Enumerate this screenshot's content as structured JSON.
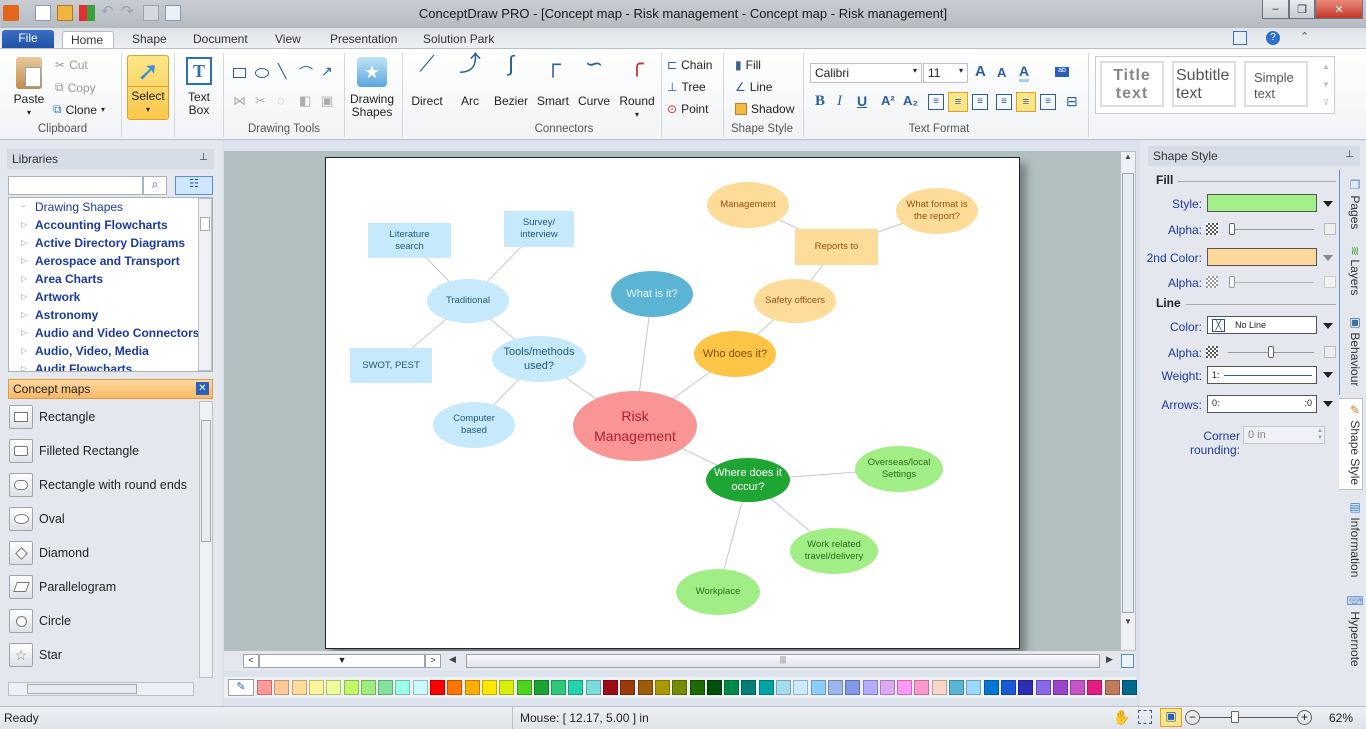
{
  "window": {
    "title": "ConceptDraw PRO - [Concept map - Risk management - Concept map - Risk management]",
    "controls": {
      "minimize": "–",
      "restore": "❐",
      "close": "✕"
    }
  },
  "quick_access": [
    "app-icon",
    "new-icon",
    "open-icon",
    "color-icon",
    "undo-icon",
    "redo-icon",
    "save-icon",
    "print-preview-icon"
  ],
  "tabs": [
    {
      "label": "File"
    },
    {
      "label": "Home",
      "active": true
    },
    {
      "label": "Shape"
    },
    {
      "label": "Document"
    },
    {
      "label": "View"
    },
    {
      "label": "Presentation"
    },
    {
      "label": "Solution Park"
    }
  ],
  "ribbon": {
    "clipboard": {
      "paste": "Paste",
      "cut": "Cut",
      "copy": "Copy",
      "clone": "Clone",
      "label": "Clipboard"
    },
    "select": {
      "label": "Select"
    },
    "textbox": {
      "label1": "Text",
      "label2": "Box"
    },
    "drawing_tools": {
      "label": "Drawing Tools"
    },
    "drawing_shapes": {
      "label1": "Drawing",
      "label2": "Shapes"
    },
    "connectors": {
      "items": [
        "Direct",
        "Arc",
        "Bezier",
        "Smart",
        "Curve",
        "Round"
      ],
      "label": "Connectors",
      "chain": "Chain",
      "tree": "Tree",
      "point": "Point"
    },
    "shape_style": {
      "fill": "Fill",
      "line": "Line",
      "shadow": "Shadow",
      "label": "Shape Style"
    },
    "text_format": {
      "font": "Calibri",
      "size": "11",
      "label": "Text Format"
    },
    "text_styles": [
      {
        "l1": "Title",
        "l2": "text"
      },
      {
        "l1": "Subtitle",
        "l2": "text"
      },
      {
        "l1": "Simple",
        "l2": "text"
      }
    ]
  },
  "libraries": {
    "title": "Libraries",
    "search_placeholder": "",
    "items": [
      "Drawing Shapes",
      "Accounting Flowcharts",
      "Active Directory Diagrams",
      "Aerospace and Transport",
      "Area Charts",
      "Artwork",
      "Astronomy",
      "Audio and Video Connectors",
      "Audio, Video, Media",
      "Audit Flowcharts"
    ],
    "active_library": "Concept maps",
    "shapes": [
      "Rectangle",
      "Filleted Rectangle",
      "Rectangle with round ends",
      "Oval",
      "Diamond",
      "Parallelogram",
      "Circle",
      "Star"
    ]
  },
  "concept_map": {
    "nodes": [
      {
        "id": "risk",
        "text": "Risk Management",
        "fill": "#f99595",
        "color": "#b0232a"
      },
      {
        "id": "whatis",
        "text": "What is it?",
        "fill": "#5bb4d3",
        "color": "#e6f4fa"
      },
      {
        "id": "who",
        "text": "Who does it?",
        "fill": "#fcc545",
        "color": "#8a4a10"
      },
      {
        "id": "where",
        "text": "Where does it occur?",
        "fill": "#1fa533",
        "color": "#ffffff"
      },
      {
        "id": "tools",
        "text": "Tools/methods used?",
        "fill": "#c6e9fb",
        "color": "#1e5a80"
      },
      {
        "id": "traditional",
        "text": "Traditional",
        "fill": "#c6e9fb",
        "color": "#1e5a80"
      },
      {
        "id": "literature",
        "text": "Literature search",
        "fill": "#c6e9fb",
        "color": "#1e5a80"
      },
      {
        "id": "survey",
        "text": "Survey/ interview",
        "fill": "#c6e9fb",
        "color": "#1e5a80"
      },
      {
        "id": "swot",
        "text": "SWOT, PEST",
        "fill": "#c6e9fb",
        "color": "#1e5a80"
      },
      {
        "id": "computer",
        "text": "Computer based",
        "fill": "#c6e9fb",
        "color": "#1e5a80"
      },
      {
        "id": "safety",
        "text": "Safety officers",
        "fill": "#fddc9a",
        "color": "#9a4f10"
      },
      {
        "id": "reports",
        "text": "Reports to",
        "fill": "#fddc9a",
        "color": "#9a4f10"
      },
      {
        "id": "management",
        "text": "Management",
        "fill": "#fddc9a",
        "color": "#9a4f10"
      },
      {
        "id": "format",
        "text": "What format is the report?",
        "fill": "#fddc9a",
        "color": "#9a4f10"
      },
      {
        "id": "overseas",
        "text": "Overseas/local Settings",
        "fill": "#a2ee86",
        "color": "#2d6b1d"
      },
      {
        "id": "travel",
        "text": "Work related travel/delivery",
        "fill": "#a2ee86",
        "color": "#2d6b1d"
      },
      {
        "id": "workplace",
        "text": "Workplace",
        "fill": "#a2ee86",
        "color": "#2d6b1d"
      }
    ],
    "edges": [
      [
        "risk",
        "whatis"
      ],
      [
        "risk",
        "who"
      ],
      [
        "risk",
        "where"
      ],
      [
        "risk",
        "tools"
      ],
      [
        "tools",
        "traditional"
      ],
      [
        "tools",
        "computer"
      ],
      [
        "traditional",
        "literature"
      ],
      [
        "traditional",
        "survey"
      ],
      [
        "traditional",
        "swot"
      ],
      [
        "who",
        "safety"
      ],
      [
        "safety",
        "reports"
      ],
      [
        "reports",
        "management"
      ],
      [
        "reports",
        "format"
      ],
      [
        "where",
        "overseas"
      ],
      [
        "where",
        "travel"
      ],
      [
        "where",
        "workplace"
      ]
    ]
  },
  "shape_style_panel": {
    "title": "Shape Style",
    "fill_header": "Fill",
    "style_label": "Style:",
    "style_color": "#a3f08a",
    "alpha_label": "Alpha:",
    "fill_alpha": 0.02,
    "second_color_label": "2nd Color:",
    "second_color": "#fdd89a",
    "second_alpha": 0.02,
    "line_header": "Line",
    "color_label": "Color:",
    "color_value": "No Line",
    "line_alpha": 0.5,
    "weight_label": "Weight:",
    "weight_value": "1:",
    "arrows_label": "Arrows:",
    "arrows_value": "0:",
    "arrows_value_right": ":0",
    "corner_label": "Corner rounding:",
    "corner_value": "0 in"
  },
  "side_tabs": [
    "Pages",
    "Layers",
    "Behaviour",
    "Shape Style",
    "Information",
    "Hypernote"
  ],
  "palette": [
    "#ff9999",
    "#ffc899",
    "#ffdc99",
    "#fff599",
    "#eeff99",
    "#c2f76a",
    "#9eed80",
    "#88e09e",
    "#99ffe8",
    "#ccf9ff",
    "#ff0000",
    "#ff7500",
    "#ffae00",
    "#ffe900",
    "#d8ef0a",
    "#4ed31f",
    "#1aa533",
    "#2bc978",
    "#23d3ac",
    "#7adcdc",
    "#9a0d15",
    "#9a3a0d",
    "#9c5c0a",
    "#a89a00",
    "#778a00",
    "#1d6b00",
    "#004f0b",
    "#008a4a",
    "#007f74",
    "#00a4a4",
    "#a4dcee",
    "#c9eaff",
    "#8dcdff",
    "#9cb5eb",
    "#8197e8",
    "#b1acff",
    "#dcaaf5",
    "#ff99f8",
    "#ff99cc",
    "#f8d5c7",
    "#5ab4d3",
    "#99d8ff",
    "#0077d3",
    "#1a5ad8",
    "#2d2db5",
    "#8a68e8",
    "#9a44c9",
    "#c754c9",
    "#e41e80",
    "#c07a5c",
    "#006a8e"
  ],
  "status": {
    "ready": "Ready",
    "mouse": "Mouse: [ 12.17, 5.00 ] in",
    "zoom": "62%",
    "zoom_fraction": 0.35
  }
}
